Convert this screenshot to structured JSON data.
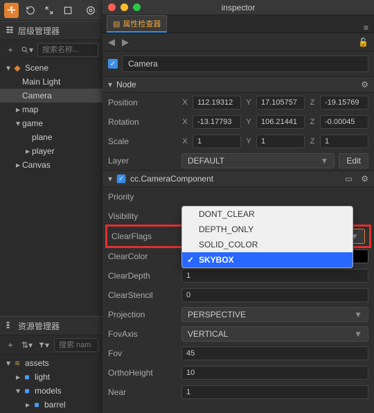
{
  "window_title": "inspector",
  "tab_label": "属性检查器",
  "hierarchy": {
    "title": "层级管理器",
    "search_placeholder": "搜索名称...",
    "items": [
      {
        "label": "Scene",
        "type": "scene"
      },
      {
        "label": "Main Light"
      },
      {
        "label": "Camera",
        "selected": true
      },
      {
        "label": "map",
        "expandable": true
      },
      {
        "label": "game",
        "expanded": true
      },
      {
        "label": "plane"
      },
      {
        "label": "player",
        "expandable": true
      },
      {
        "label": "Canvas",
        "expandable": true
      }
    ]
  },
  "assets": {
    "title": "资源管理器",
    "search_placeholder": "搜索 nam",
    "items": [
      {
        "label": "assets",
        "type": "db"
      },
      {
        "label": "light",
        "type": "folder"
      },
      {
        "label": "models",
        "type": "folder",
        "expanded": true
      },
      {
        "label": "barrel",
        "type": "folder"
      }
    ]
  },
  "inspector": {
    "node_name": "Camera",
    "node_section": "Node",
    "position": {
      "label": "Position",
      "x": "112.19312",
      "y": "17.105757",
      "z": "-19.15769"
    },
    "rotation": {
      "label": "Rotation",
      "x": "-13.17793",
      "y": "106.21441",
      "z": "-0.00045"
    },
    "scale": {
      "label": "Scale",
      "x": "1",
      "y": "1",
      "z": "1"
    },
    "layer": {
      "label": "Layer",
      "value": "DEFAULT",
      "edit": "Edit"
    },
    "component": "cc.CameraComponent",
    "priority": {
      "label": "Priority"
    },
    "visibility": {
      "label": "Visibility"
    },
    "clearflags": {
      "label": "ClearFlags",
      "value": "SKYBOX"
    },
    "clearflags_options": [
      "DONT_CLEAR",
      "DEPTH_ONLY",
      "SOLID_COLOR",
      "SKYBOX"
    ],
    "clearcolor": {
      "label": "ClearColor"
    },
    "cleardepth": {
      "label": "ClearDepth",
      "value": "1"
    },
    "clearstencil": {
      "label": "ClearStencil",
      "value": "0"
    },
    "projection": {
      "label": "Projection",
      "value": "PERSPECTIVE"
    },
    "fovaxis": {
      "label": "FovAxis",
      "value": "VERTICAL"
    },
    "fov": {
      "label": "Fov",
      "value": "45"
    },
    "orthoheight": {
      "label": "OrthoHeight",
      "value": "10"
    },
    "near": {
      "label": "Near",
      "value": "1"
    }
  }
}
